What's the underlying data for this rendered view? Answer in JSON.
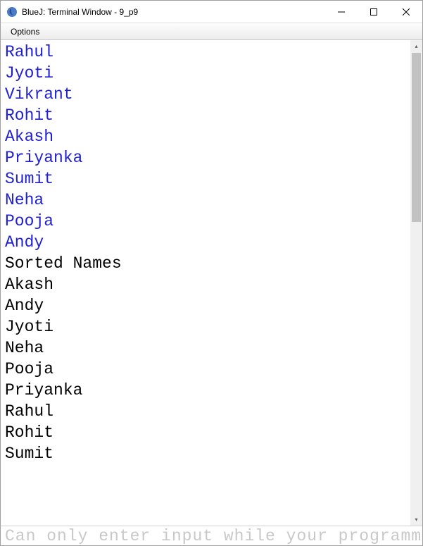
{
  "window": {
    "title": "BlueJ: Terminal Window - 9_p9"
  },
  "menubar": {
    "options_label": "Options"
  },
  "terminal": {
    "input_lines": [
      "Rahul",
      "Jyoti",
      "Vikrant",
      "Rohit",
      "Akash",
      "Priyanka",
      "Sumit",
      "Neha",
      "Pooja",
      "Andy"
    ],
    "output_lines": [
      "Sorted Names",
      "Akash",
      "Andy",
      "Jyoti",
      "Neha",
      "Pooja",
      "Priyanka",
      "Rahul",
      "Rohit",
      "Sumit"
    ]
  },
  "footer": {
    "status_text": "Can only enter input while your programmi"
  }
}
